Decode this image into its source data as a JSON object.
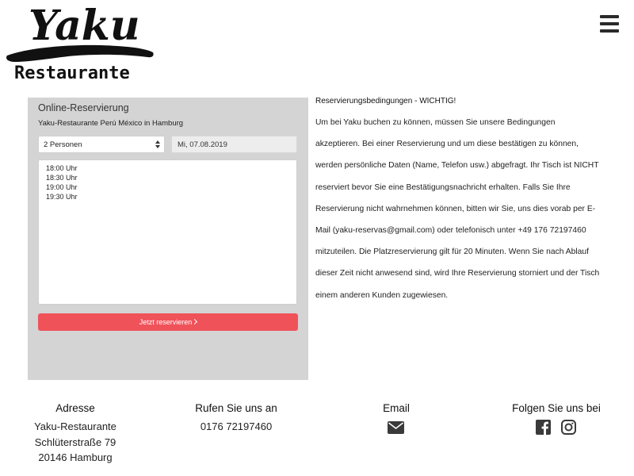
{
  "header": {
    "logo_wordmark": "Yaku",
    "logo_subtitle": "Restaurante",
    "menu_icon": "hamburger-menu-icon"
  },
  "reservation": {
    "title": "Online-Reservierung",
    "subtitle": "Yaku-Restaurante Perú México in Hamburg",
    "persons_selected": "2 Personen",
    "date_value": "Mi, 07.08.2019",
    "times": [
      "18:00 Uhr",
      "18:30 Uhr",
      "19:00 Uhr",
      "19:30 Uhr"
    ],
    "button_label": "Jetzt reservieren",
    "button_color": "#f0525a",
    "panel_color": "#d4d4d4"
  },
  "conditions": {
    "heading": "Reservierungsbedingungen - WICHTIG!",
    "body": "Um bei Yaku buchen zu können, müssen Sie unsere Bedingungen akzeptieren. Bei einer Reservierung und um diese bestätigen zu können, werden persönliche Daten (Name, Telefon usw.) abgefragt. Ihr Tisch ist NICHT reserviert bevor Sie eine Bestätigungsnachricht erhalten. Falls Sie Ihre Reservierung nicht wahrnehmen können, bitten wir Sie, uns dies vorab per E-Mail (yaku-reservas@gmail.com) oder telefonisch unter +49 176 72197460 mitzuteilen. Die Platzreservierung gilt für 20 Minuten. Wenn Sie nach Ablauf dieser Zeit nicht anwesend sind, wird Ihre Reservierung storniert und der Tisch einem anderen Kunden zugewiesen."
  },
  "footer": {
    "address": {
      "heading": "Adresse",
      "name": "Yaku-Restaurante",
      "street": "Schlüterstraße 79",
      "city": "20146 Hamburg"
    },
    "phone": {
      "heading": "Rufen Sie uns an",
      "number": "0176 72197460"
    },
    "email": {
      "heading": "Email",
      "icon": "envelope-icon"
    },
    "social": {
      "heading": "Folgen Sie uns bei",
      "icons": [
        "facebook-icon",
        "instagram-icon"
      ]
    }
  }
}
